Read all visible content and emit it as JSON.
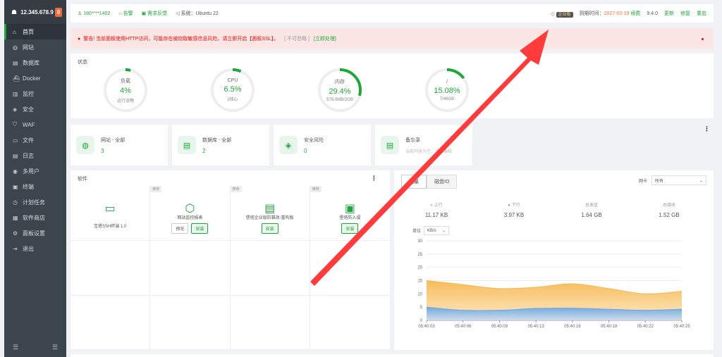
{
  "sidebar": {
    "server_ip": "12.345.678.9",
    "badge": "0",
    "items": [
      {
        "label": "首页",
        "icon": "home-icon"
      },
      {
        "label": "网站",
        "icon": "globe-icon"
      },
      {
        "label": "数据库",
        "icon": "database-icon"
      },
      {
        "label": "Docker",
        "icon": "docker-icon"
      },
      {
        "label": "监控",
        "icon": "monitor-icon"
      },
      {
        "label": "安全",
        "icon": "shield-icon"
      },
      {
        "label": "WAF",
        "icon": "waf-icon"
      },
      {
        "label": "文件",
        "icon": "folder-icon"
      },
      {
        "label": "日志",
        "icon": "log-icon"
      },
      {
        "label": "多用户",
        "icon": "users-icon"
      },
      {
        "label": "终端",
        "icon": "terminal-icon"
      },
      {
        "label": "计划任务",
        "icon": "clock-icon"
      },
      {
        "label": "软件商店",
        "icon": "store-icon"
      },
      {
        "label": "面板设置",
        "icon": "gear-icon"
      },
      {
        "label": "退出",
        "icon": "logout-icon"
      }
    ]
  },
  "topbar": {
    "user": "180****1402",
    "alarm": "告警",
    "feedback": "需求反馈",
    "system": "系统：Ubuntu 22",
    "pro_badge": "企业版",
    "expire_label": "到期时间：",
    "expire_date": "2027-02-19",
    "renew": "续费",
    "version": "9.4.0",
    "update": "更新",
    "repair": "修复",
    "restart": "重启"
  },
  "alert": {
    "text": "警告! 当前面板使用HTTP访问，可能存在被窃取敏感信息风险，请立即开启【面板SSL】。",
    "ignore": "[ 不可忽略 ]",
    "handle": "[立即处理]"
  },
  "status": {
    "title": "状态",
    "gauges": [
      {
        "label": "负载",
        "value": "4%",
        "sub": "运行流畅",
        "fraction": 0.04
      },
      {
        "label": "CPU",
        "value": "6.5%",
        "sub": "2核心",
        "fraction": 0.065
      },
      {
        "label": "内存",
        "value": "29.4%",
        "sub": "578.0MB/2GB",
        "fraction": 0.294
      },
      {
        "label": "/",
        "value": "15.08%",
        "sub": "7/48GB",
        "fraction": 0.1508
      }
    ]
  },
  "stats": [
    {
      "title": "网站 - 全部",
      "value": "3",
      "icon": "globe-icon"
    },
    {
      "title": "数据库 - 全部",
      "value": "2",
      "icon": "database-icon"
    },
    {
      "title": "安全风险",
      "value": "0",
      "icon": "shield-icon"
    },
    {
      "title": "备忘录",
      "value": "当前内容为空，点击编辑",
      "icon": "memo-icon"
    }
  ],
  "software": {
    "title": "软件",
    "items": [
      {
        "name": "宝塔SSH终端 1.0",
        "tag": "",
        "buttons": []
      },
      {
        "name": "网站监控报表",
        "tag": "推荐",
        "buttons": [
          "预览",
          "安装"
        ]
      },
      {
        "name": "堡塔企业级防篡改-重构版",
        "tag": "推荐",
        "buttons": [
          "安装"
        ]
      },
      {
        "name": "堡塔防入侵",
        "tag": "推荐",
        "buttons": [
          "安装"
        ]
      }
    ]
  },
  "flow": {
    "tabs": [
      "流量",
      "磁盘IO"
    ],
    "nic_label": "网卡",
    "nic_value": "所有",
    "stats": [
      {
        "label": "上行",
        "value": "11.17 KB",
        "color": "#f7b851"
      },
      {
        "label": "下行",
        "value": "3.97 KB",
        "color": "#52a9ff"
      },
      {
        "label": "总发送",
        "value": "1.64 GB"
      },
      {
        "label": "总接收",
        "value": "1.52 GB"
      }
    ],
    "unit_label": "单位",
    "unit_value": "KB/s"
  },
  "chart_data": {
    "type": "area",
    "x": [
      "05:40:03",
      "05:40:06",
      "05:40:09",
      "05:40:13",
      "05:40:16",
      "05:40:19",
      "05:40:22",
      "05:40:25"
    ],
    "ylim": [
      0,
      30
    ],
    "yticks": [
      0,
      5,
      10,
      15,
      20,
      25,
      30
    ],
    "series": [
      {
        "name": "上行",
        "color": "#f7b851",
        "values": [
          15,
          13.5,
          12,
          12.5,
          13.8,
          12,
          10,
          11
        ]
      },
      {
        "name": "下行",
        "color": "#6aa6e0",
        "values": [
          5,
          3.8,
          3.8,
          4.5,
          4.6,
          4.2,
          3.8,
          4.2
        ]
      }
    ]
  }
}
